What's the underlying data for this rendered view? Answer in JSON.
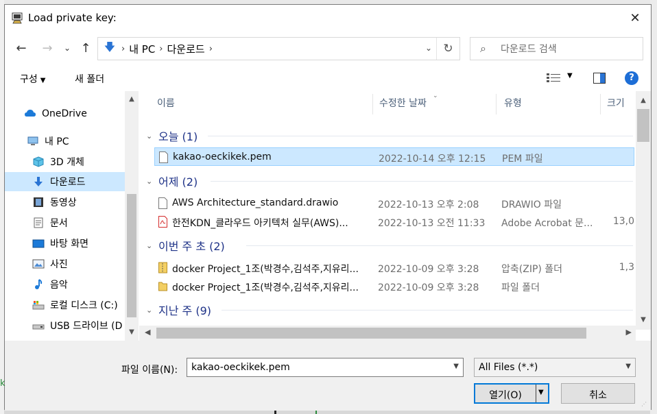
{
  "dialog": {
    "title": "Load private key:",
    "close_glyph": "✕"
  },
  "navbar": {
    "back_glyph": "←",
    "forward_glyph": "→",
    "recent_glyph": "⌄",
    "up_glyph": "↑",
    "breadcrumbs": [
      "내 PC",
      "다운로드"
    ],
    "crumb_sep": "›",
    "address_dropdown_glyph": "⌄",
    "refresh_glyph": "↻",
    "search_placeholder": "다운로드 검색"
  },
  "toolbar": {
    "organize_label": "구성",
    "new_folder_label": "새 폴더",
    "help_label": "?"
  },
  "sidebar": {
    "items": [
      {
        "label": "OneDrive",
        "icon": "cloud-icon"
      },
      {
        "label": "내 PC",
        "icon": "computer-icon"
      },
      {
        "label": "3D 개체",
        "icon": "cube-3d-icon"
      },
      {
        "label": "다운로드",
        "icon": "download-icon",
        "selected": true
      },
      {
        "label": "동영상",
        "icon": "video-icon"
      },
      {
        "label": "문서",
        "icon": "document-icon"
      },
      {
        "label": "바탕 화면",
        "icon": "desktop-icon"
      },
      {
        "label": "사진",
        "icon": "pictures-icon"
      },
      {
        "label": "음악",
        "icon": "music-icon"
      },
      {
        "label": "로컬 디스크 (C:)",
        "icon": "disk-icon"
      },
      {
        "label": "USB 드라이브 (D",
        "icon": "usb-drive-icon"
      }
    ]
  },
  "columns": {
    "name": "이름",
    "date": "수정한 날짜",
    "type": "유형",
    "size": "크기"
  },
  "groups": [
    {
      "label": "오늘 (1)",
      "files": [
        {
          "name": "kakao-oeckikek.pem",
          "date": "2022-10-14 오후 12:15",
          "type": "PEM 파일",
          "size": "",
          "icon": "file-icon",
          "selected": true
        }
      ]
    },
    {
      "label": "어제 (2)",
      "files": [
        {
          "name": "AWS Architecture_standard.drawio",
          "date": "2022-10-13 오후 2:08",
          "type": "DRAWIO 파일",
          "size": "",
          "icon": "file-icon"
        },
        {
          "name": "한전KDN_클라우드 아키텍처 실무(AWS)...",
          "date": "2022-10-13 오전 11:33",
          "type": "Adobe Acrobat 문...",
          "size": "13,0",
          "icon": "pdf-icon"
        }
      ]
    },
    {
      "label": "이번 주 초 (2)",
      "files": [
        {
          "name": "docker Project_1조(박경수,김석주,지유리...",
          "date": "2022-10-09 오후 3:28",
          "type": "압축(ZIP) 폴더",
          "size": "1,3",
          "icon": "zip-folder-icon"
        },
        {
          "name": "docker Project_1조(박경수,김석주,지유리...",
          "date": "2022-10-09 오후 3:28",
          "type": "파일 폴더",
          "size": "",
          "icon": "folder-icon"
        }
      ]
    },
    {
      "label": "지난 주 (9)",
      "files": []
    }
  ],
  "bottom": {
    "filename_label": "파일 이름(N):",
    "filename_value": "kakao-oeckikek.pem",
    "filetype_value": "All Files (*.*)",
    "open_label": "열기(O)",
    "cancel_label": "취소"
  },
  "colors": {
    "selection": "#cce8ff",
    "selection_border": "#99d1ff",
    "group_text": "#1e3287",
    "accent": "#0078d7"
  }
}
